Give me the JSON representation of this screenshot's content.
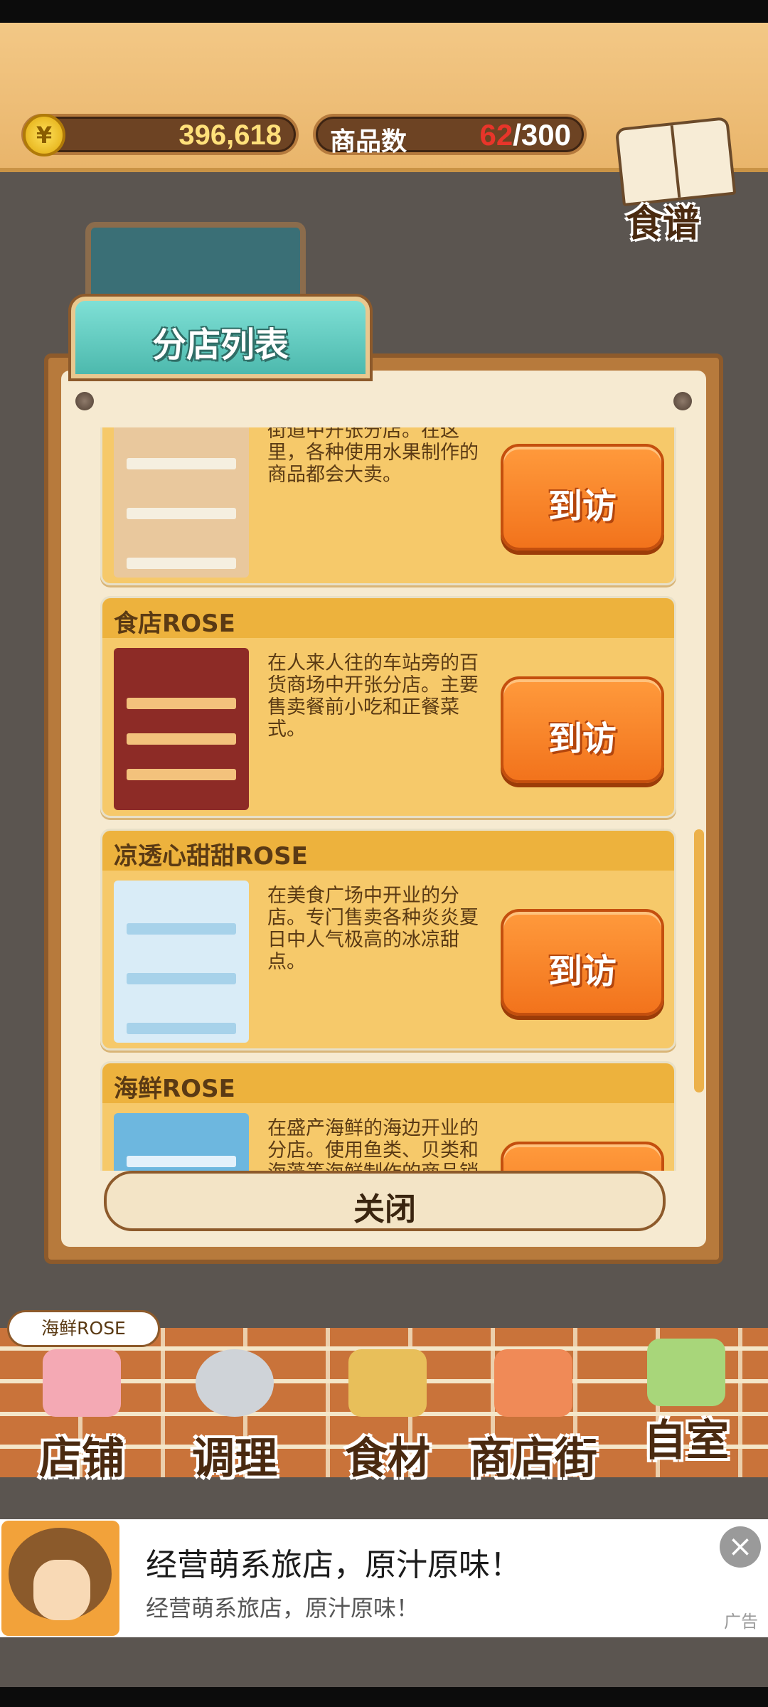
{
  "header": {
    "coin_symbol": "¥",
    "coins": "396,618",
    "items_label": "商品数",
    "items_current": "62",
    "items_max": "/300",
    "recipe_label": "食谱"
  },
  "dialog": {
    "title": "分店列表",
    "close_label": "关闭",
    "branches": [
      {
        "name": "",
        "description": "街道中开张分店。在这里，各种使用水果制作的商品都会大卖。",
        "visit_label": "到访"
      },
      {
        "name": "食店ROSE",
        "description": "在人来人往的车站旁的百货商场中开张分店。主要售卖餐前小吃和正餐菜式。",
        "visit_label": "到访"
      },
      {
        "name": "凉透心甜甜ROSE",
        "description": "在美食广场中开业的分店。专门售卖各种炎炎夏日中人气极高的冰凉甜点。",
        "visit_label": "到访"
      },
      {
        "name": "海鲜ROSE",
        "description": "在盛产海鲜的海边开业的分店。使用鱼类、贝类和海藻等海鲜制作的商品销量会更好。",
        "visit_label": "到访"
      }
    ]
  },
  "current_shop": "海鲜ROSE",
  "nav": [
    {
      "label": "店铺",
      "icon": "cake-icon"
    },
    {
      "label": "调理",
      "icon": "mixing-bowl-icon"
    },
    {
      "label": "食材",
      "icon": "flour-sack-icon"
    },
    {
      "label": "商店街",
      "icon": "storefront-icon"
    },
    {
      "label": "自室",
      "icon": "staff-only-sign-icon"
    }
  ],
  "ad": {
    "title": "经营萌系旅店，原汁原味！",
    "subtitle": "经营萌系旅店，原汁原味！",
    "tag": "广告",
    "close_icon": "close-icon"
  }
}
